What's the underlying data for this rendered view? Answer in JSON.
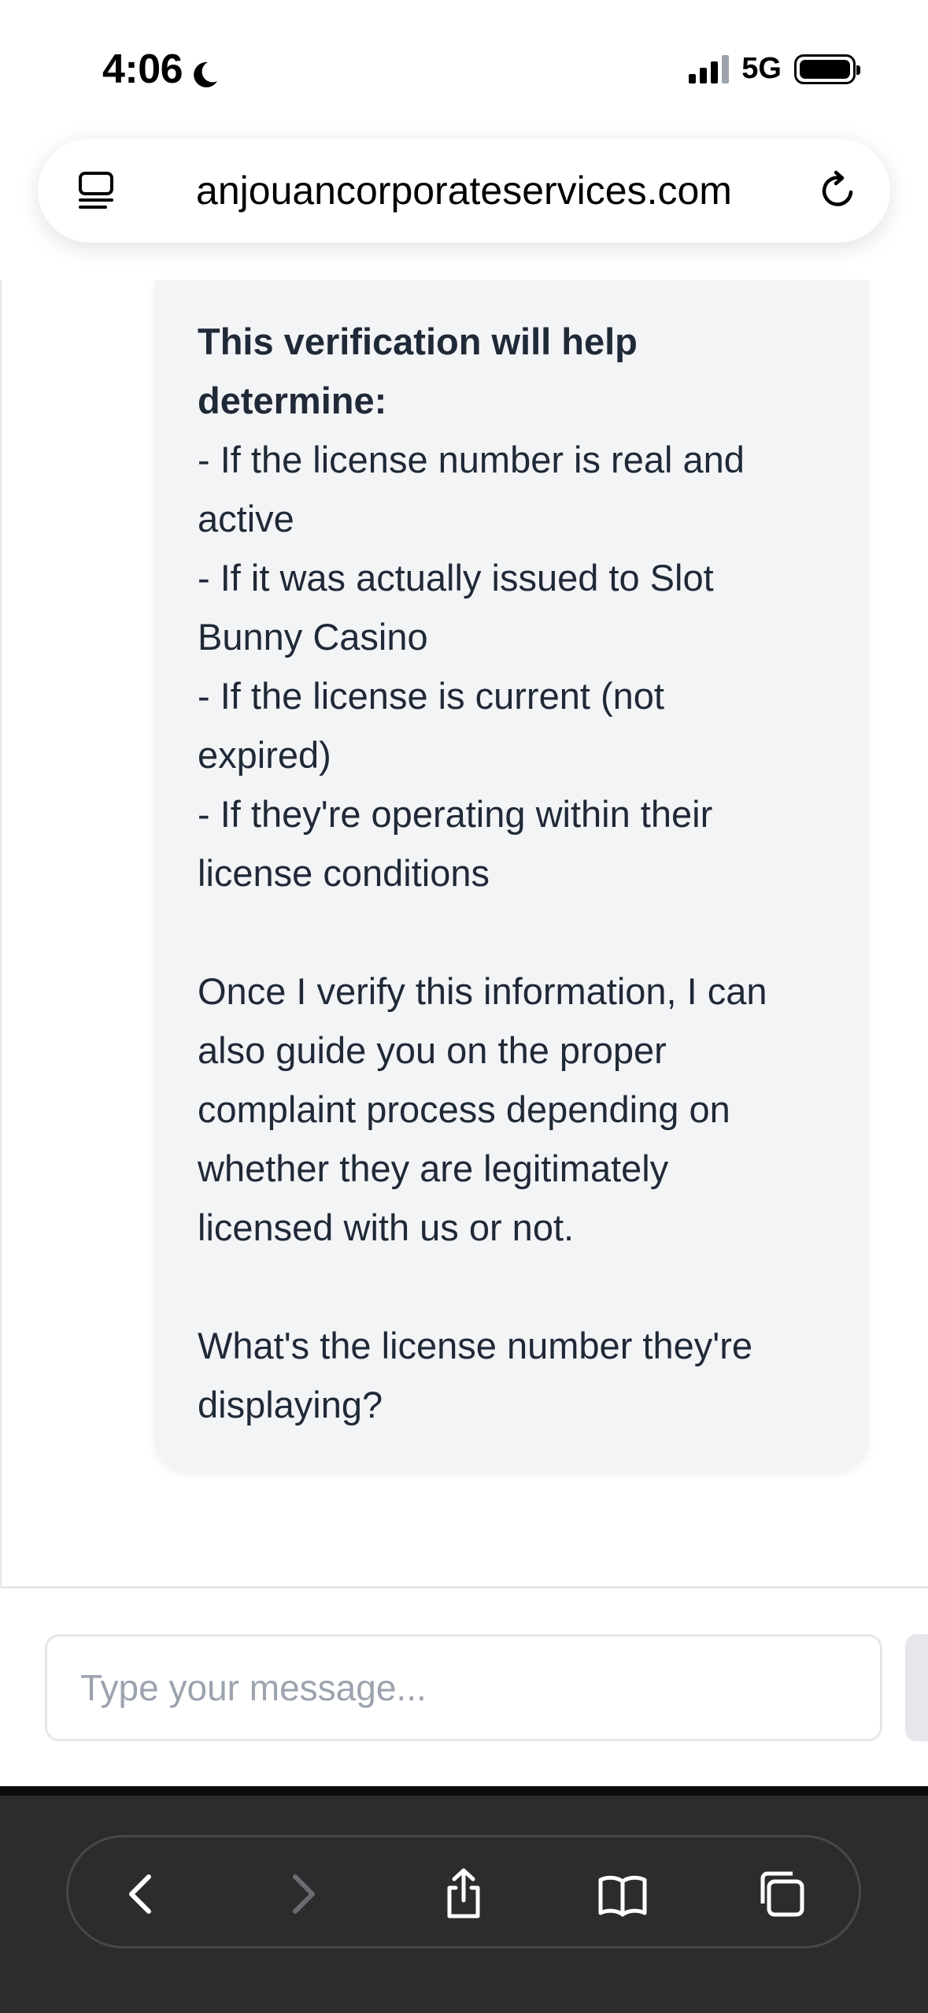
{
  "status_bar": {
    "time": "4:06",
    "network": "5G"
  },
  "address_bar": {
    "url": "anjouancorporateservices.com"
  },
  "message": {
    "heading_lines": [
      "This verification will help",
      "determine:"
    ],
    "lines_block1": [
      "- If the license number is real and",
      "active",
      "- If it was actually issued to Slot",
      "Bunny Casino",
      "- If the license is current (not",
      "expired)",
      "- If they're operating within their",
      "license conditions"
    ],
    "lines_block2": [
      "Once I verify this information, I can",
      "also guide you on the proper",
      "complaint process depending on",
      "whether they are legitimately",
      "licensed with us or not."
    ],
    "lines_block3": [
      "What's the license number they're",
      "displaying?"
    ]
  },
  "composer": {
    "placeholder": "Type your message..."
  },
  "toolbar": {
    "icons": [
      "back-icon",
      "forward-icon",
      "share-icon",
      "bookmarks-icon",
      "tabs-icon"
    ]
  },
  "colors": {
    "bubble_bg": "#f3f4f6",
    "text": "#1f2937",
    "toolbar_bg": "#2c2c2e"
  }
}
